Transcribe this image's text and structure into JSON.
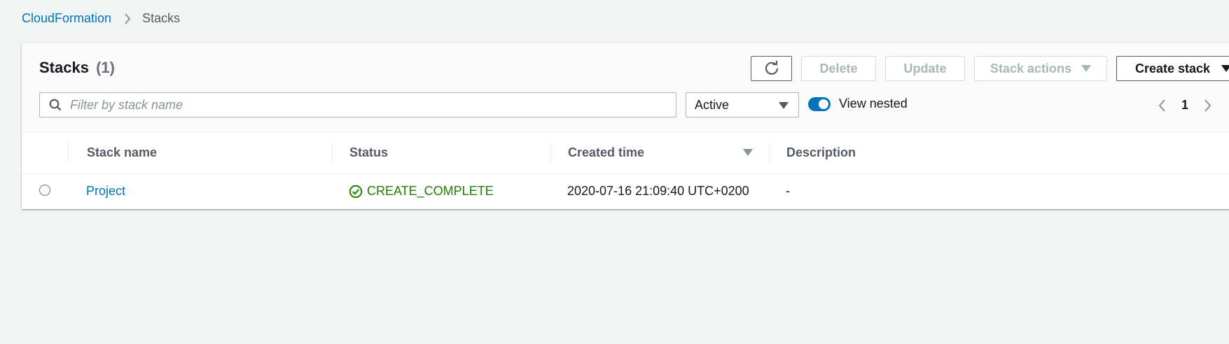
{
  "breadcrumb": {
    "root": "CloudFormation",
    "current": "Stacks"
  },
  "header": {
    "title": "Stacks",
    "count": "(1)"
  },
  "toolbar": {
    "refresh_icon": "refresh-icon",
    "delete_label": "Delete",
    "update_label": "Update",
    "stack_actions_label": "Stack actions",
    "create_stack_label": "Create stack"
  },
  "filter": {
    "search_placeholder": "Filter by stack name",
    "status_value": "Active",
    "view_nested_label": "View nested",
    "view_nested_on": true
  },
  "pagination": {
    "current_page": "1"
  },
  "table": {
    "columns": [
      "Stack name",
      "Status",
      "Created time",
      "Description"
    ],
    "sorted_column": "Created time",
    "rows": [
      {
        "name": "Project",
        "status": "CREATE_COMPLETE",
        "created": "2020-07-16 21:09:40 UTC+0200",
        "description": "-"
      }
    ]
  },
  "colors": {
    "link": "#0073bb",
    "success": "#1d8102",
    "toggle_on": "#0073bb"
  }
}
